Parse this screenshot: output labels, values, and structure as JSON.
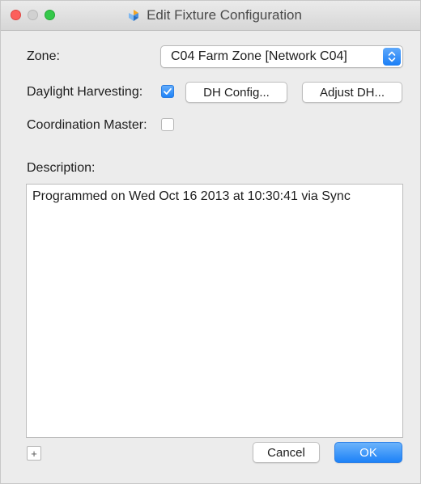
{
  "window": {
    "title": "Edit Fixture Configuration"
  },
  "form": {
    "zone_label": "Zone:",
    "zone_value": "C04 Farm Zone [Network C04]",
    "daylight_label": "Daylight Harvesting:",
    "daylight_checked": true,
    "dh_config_label": "DH Config...",
    "adjust_dh_label": "Adjust DH...",
    "coordination_label": "Coordination Master:",
    "coordination_checked": false,
    "description_label": "Description:",
    "description_value": "Programmed on Wed Oct 16 2013 at 10:30:41 via Sync"
  },
  "footer": {
    "plus_label": "+",
    "cancel_label": "Cancel",
    "ok_label": "OK"
  },
  "colors": {
    "accent": "#1d82f7",
    "close": "#fc605c",
    "zoom": "#35c84a"
  },
  "icons": {
    "app": "app-icon",
    "checkmark": "check-icon",
    "popup_arrows": "up-down-arrows-icon"
  }
}
